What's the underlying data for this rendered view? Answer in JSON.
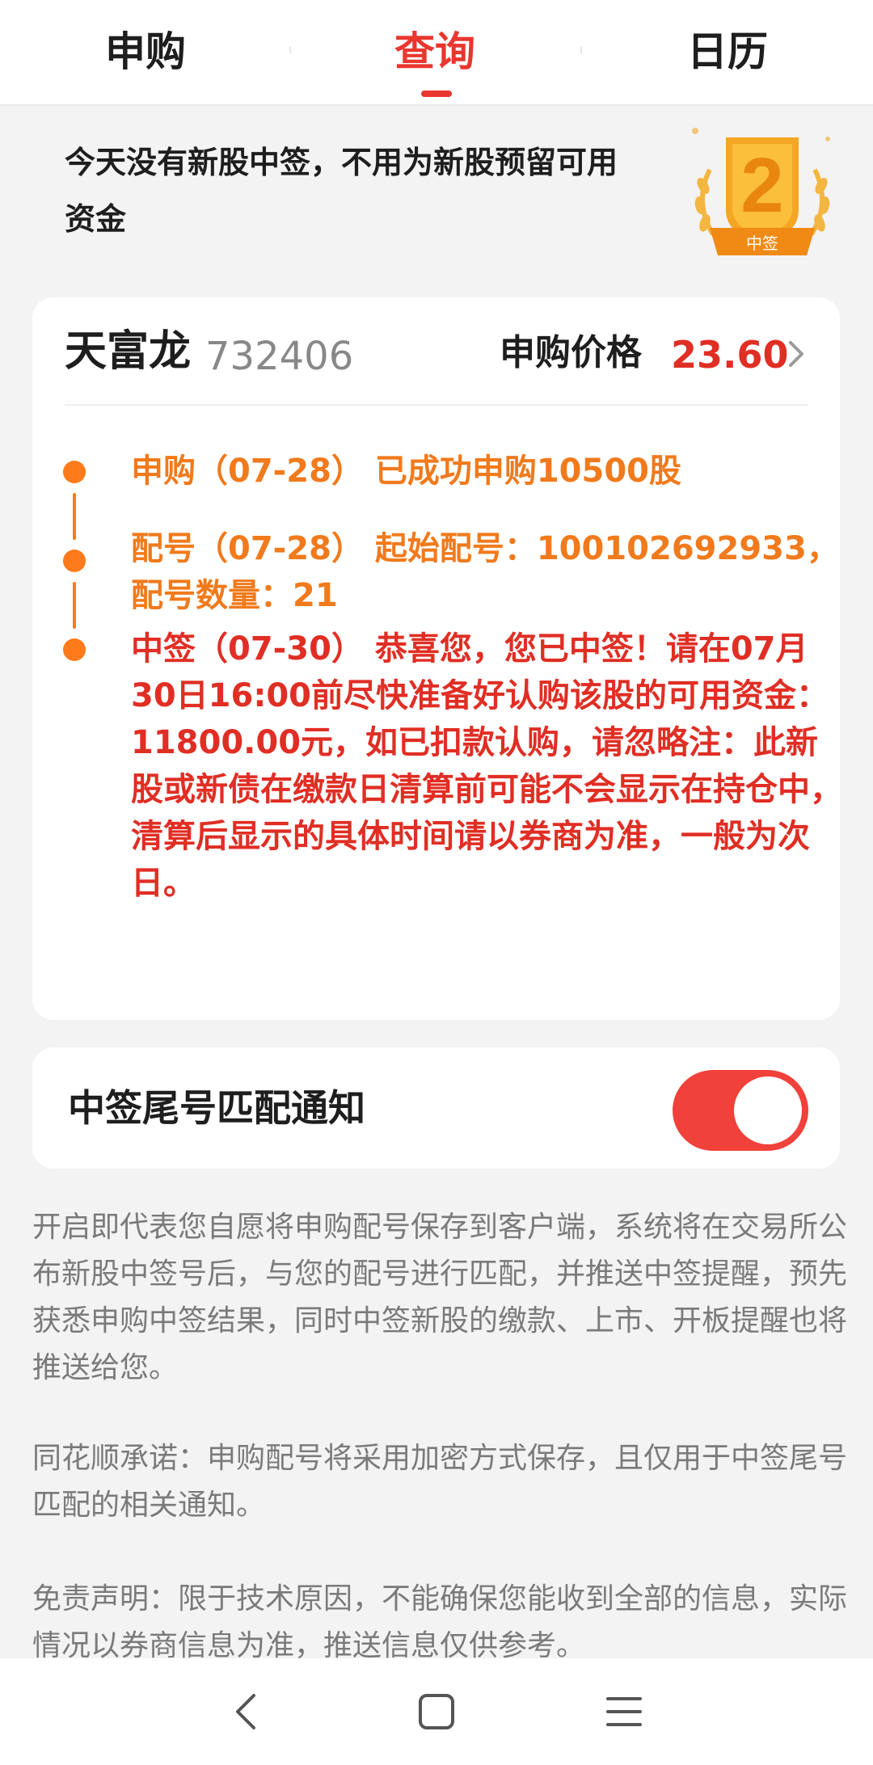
{
  "tabs": [
    {
      "label": "申购",
      "active": false
    },
    {
      "label": "查询",
      "active": true
    },
    {
      "label": "日历",
      "active": false
    }
  ],
  "notice": {
    "text": "今天没有新股中签，不用为新股预留可用资金",
    "badge_number": "2",
    "badge_label": "中签"
  },
  "stock": {
    "name": "天富龙",
    "code": "732406",
    "price_label": "申购价格",
    "price": "23.60"
  },
  "timeline": [
    {
      "text": "申购（07-28） 已成功申购10500股",
      "color": "#f07a1c"
    },
    {
      "text": "配号（07-28） 起始配号：100102692933，配号数量：21",
      "color": "#f07a1c"
    },
    {
      "text": "中签（07-30） 恭喜您，您已中签！请在07月30日16:00前尽快准备好认购该股的可用资金：11800.00元，如已扣款认购，请忽略注：此新股或新债在缴款日清算前可能不会显示在持仓中，清算后显示的具体时间请以券商为准，一般为次日。",
      "color": "#e02e24"
    }
  ],
  "notification": {
    "label": "中签尾号匹配通知",
    "enabled": true
  },
  "descriptions": [
    "开启即代表您自愿将申购配号保存到客户端，系统将在交易所公布新股中签号后，与您的配号进行匹配，并推送中签提醒，预先获悉申购中签结果，同时中签新股的缴款、上市、开板提醒也将推送给您。",
    "同花顺承诺：申购配号将采用加密方式保存，且仅用于中签尾号匹配的相关通知。",
    "免责声明：限于技术原因，不能确保您能收到全部的信息，实际情况以券商信息为准，推送信息仅供参考。"
  ],
  "navbar": {
    "icons": [
      "back-icon",
      "home-icon",
      "menu-icon"
    ]
  },
  "colors": {
    "accent": "#e8372f",
    "orange": "#f07a1c",
    "red": "#e02e24",
    "toggle_on": "#f0413a"
  }
}
